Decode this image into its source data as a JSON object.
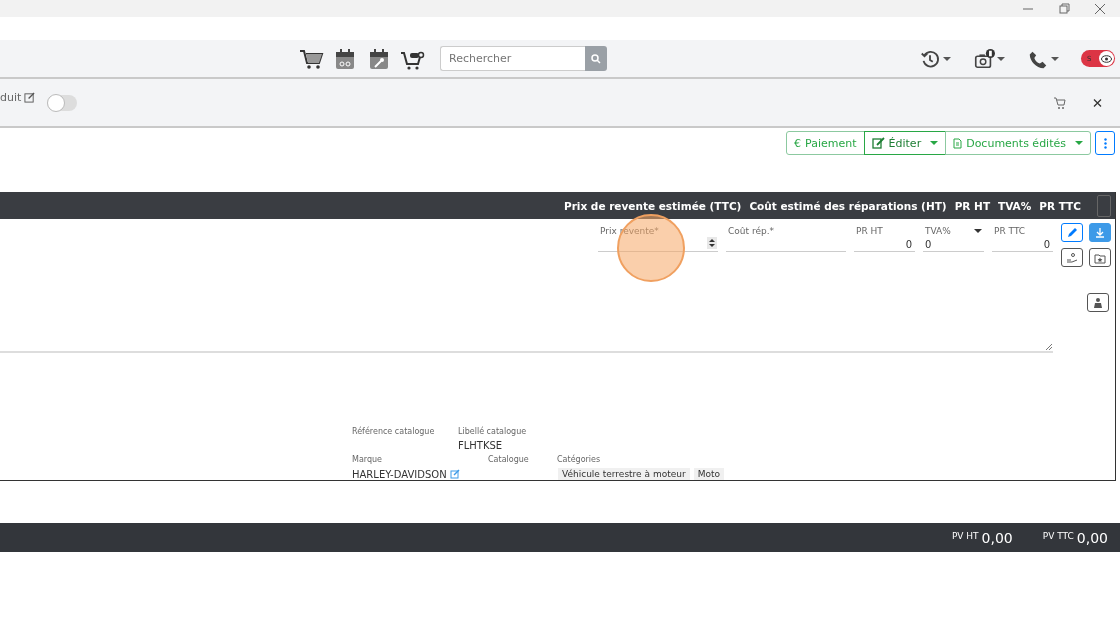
{
  "toolbar": {
    "search": {
      "placeholder": "Rechercher"
    },
    "status_toggle": {
      "label": "S",
      "on": true
    }
  },
  "subheader": {
    "title": "duit",
    "toggle_on": false
  },
  "actions": [
    {
      "kind": "euro",
      "icon_text": "€",
      "label": "Paiement",
      "dropdown": false
    },
    {
      "kind": "edit",
      "label": "Éditer",
      "dropdown": true
    },
    {
      "kind": "doc",
      "label": "Documents édités",
      "dropdown": true
    }
  ],
  "panel": {
    "columns": [
      "Prix de revente estimée (TTC)",
      "Coût estimé des réparations (HT)",
      "PR HT",
      "TVA%",
      "PR TTC"
    ],
    "fields": [
      {
        "label": "Prix revente*",
        "kind": "spinner"
      },
      {
        "label": "Coût rép.*",
        "kind": "text"
      },
      {
        "label": "PR HT",
        "value": "0",
        "kind": "number"
      },
      {
        "label": "TVA%",
        "value": "0",
        "kind": "select"
      },
      {
        "label": "PR TTC",
        "value": "0",
        "kind": "number"
      }
    ],
    "catalogue": {
      "reference_label": "Référence catalogue",
      "libelle_label": "Libellé catalogue",
      "libelle_value": "FLHTKSE",
      "marque_label": "Marque",
      "marque_value": "HARLEY-DAVIDSON",
      "catalogue_label": "Catalogue",
      "categories_label": "Catégories",
      "categories": [
        "Véhicule terrestre à moteur",
        "Moto"
      ]
    }
  },
  "totals": [
    {
      "label": "PV HT",
      "value": "0,00"
    },
    {
      "label": "PV TTC",
      "value": "0,00"
    }
  ]
}
